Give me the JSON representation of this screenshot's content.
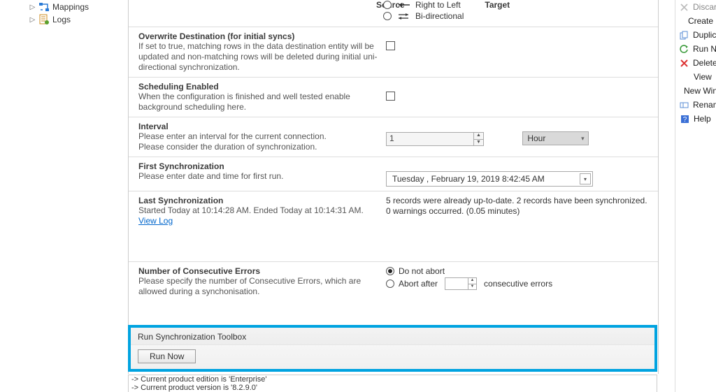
{
  "tree": {
    "items": [
      {
        "label": "Mappings"
      },
      {
        "label": "Logs"
      }
    ]
  },
  "direction": {
    "source_label": "Source",
    "target_label": "Target",
    "options": [
      {
        "label": "Right to Left"
      },
      {
        "label": "Bi-directional"
      }
    ]
  },
  "overwrite": {
    "title": "Overwrite Destination (for initial syncs)",
    "desc": "If set to true, matching rows in the data destination entity will be updated and non-matching rows will be deleted during initial uni-directional synchronization."
  },
  "scheduling": {
    "title": "Scheduling Enabled",
    "desc": "When the configuration is finished and well tested enable background scheduling here."
  },
  "interval": {
    "title": "Interval",
    "desc1": "Please enter an interval for the current connection.",
    "desc2": "Please consider the duration of synchronization.",
    "value": "1",
    "unit": "Hour"
  },
  "first_sync": {
    "title": "First Synchronization",
    "desc": "Please enter date and time for first run.",
    "date_display": "Tuesday ,   February   19, 2019   8:42:45 AM"
  },
  "last_sync": {
    "title": "Last Synchronization",
    "desc_prefix": "Started  Today at 10:14:28 AM. Ended Today at 10:14:31 AM. ",
    "link": "View Log",
    "result": "5 records were already up-to-date. 2 records have been synchronized. 0 warnings occurred. (0.05 minutes)"
  },
  "errors": {
    "title": "Number of Consecutive Errors",
    "desc": "Please specify the number of Consecutive Errors, which are allowed during a synchonisation.",
    "opt_noabort": "Do not abort",
    "opt_abort_prefix": "Abort after",
    "opt_abort_suffix": "consecutive errors"
  },
  "toolbox": {
    "title": "Run Synchronization Toolbox",
    "run_now": "Run Now"
  },
  "log": {
    "line1": "-> Current product edition is 'Enterprise'",
    "line2": "-> Current product version is '8.2.9.0'"
  },
  "cmd": {
    "items": [
      {
        "label": "Discard"
      },
      {
        "label": "Create"
      },
      {
        "label": "Duplicate"
      },
      {
        "label": "Run Now"
      },
      {
        "label": "Delete"
      },
      {
        "label": "View"
      },
      {
        "label": "New Window"
      },
      {
        "label": "Rename"
      },
      {
        "label": "Help"
      }
    ]
  }
}
